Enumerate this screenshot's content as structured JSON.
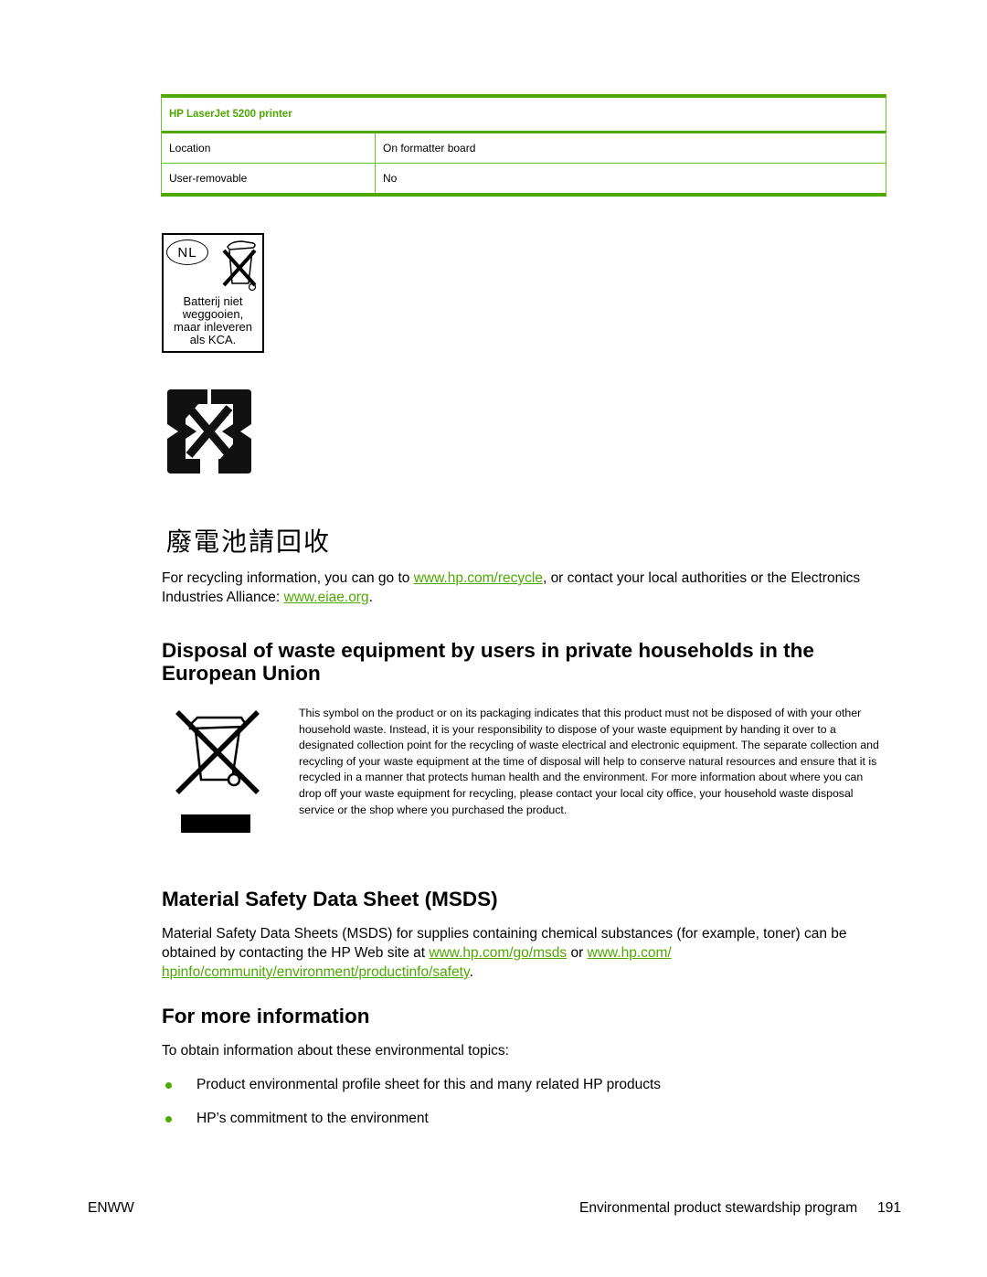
{
  "table": {
    "title": "HP LaserJet 5200 printer",
    "rows": [
      {
        "label": "Location",
        "value": "On formatter board"
      },
      {
        "label": "User-removable",
        "value": "No"
      }
    ]
  },
  "nl_label": {
    "country": "NL",
    "lines": [
      "Batterij niet",
      "weggooien,",
      "maar inleveren",
      "als KCA."
    ]
  },
  "chinese_text": "廢電池請回收",
  "recycling_paragraph": {
    "part1": "For recycling information, you can go to ",
    "link1": "www.hp.com/recycle",
    "part2": ", or contact your local authorities or the Electronics Industries Alliance: ",
    "link2": "www.eiae.org",
    "part3": "."
  },
  "eu_section": {
    "heading": "Disposal of waste equipment by users in private households in the European Union",
    "body": "This symbol on the product or on its packaging indicates that this product must not be disposed of with your other household waste. Instead, it is your responsibility to dispose of your waste equipment by handing it over to a designated collection point for the recycling of waste electrical and electronic equipment. The separate collection and recycling of your waste equipment at the time of disposal will help to conserve natural resources and ensure that it is recycled in a manner that protects human health and the environment. For more information about where you can drop off your waste equipment for recycling, please contact your local city office, your household waste disposal service or the shop where you purchased the product."
  },
  "msds_section": {
    "heading": "Material Safety Data Sheet (MSDS)",
    "part1": "Material Safety Data Sheets (MSDS) for supplies containing chemical substances (for example, toner) can be obtained by contacting the HP Web site at ",
    "link1": "www.hp.com/go/msds",
    "part2": " or ",
    "link2": "www.hp.com/ hpinfo/community/environment/productinfo/safety",
    "part3": "."
  },
  "more_info_section": {
    "heading": "For more information",
    "intro": "To obtain information about these environmental topics:",
    "bullets": [
      "Product environmental profile sheet for this and many related HP products",
      "HP’s commitment to the environment"
    ]
  },
  "footer": {
    "left": "ENWW",
    "section": "Environmental product stewardship program",
    "page_number": "191"
  },
  "colors": {
    "accent_green": "#4fa800",
    "text": "#000000"
  }
}
